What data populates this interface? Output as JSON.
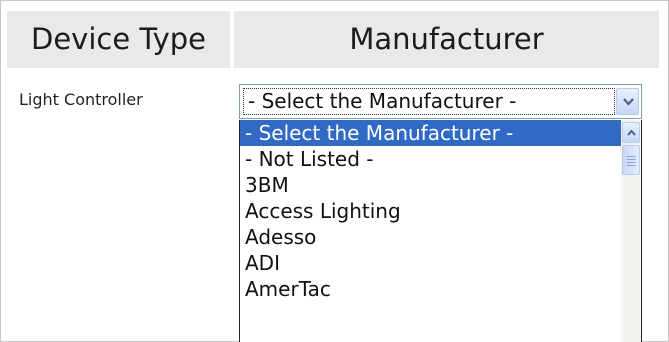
{
  "table": {
    "headers": {
      "device_type": "Device Type",
      "manufacturer": "Manufacturer"
    },
    "row": {
      "label": "Light Controller"
    }
  },
  "select": {
    "value": "- Select the Manufacturer -",
    "options": [
      "- Select the Manufacturer -",
      "- Not Listed -",
      "3BM",
      "Access Lighting",
      "Adesso",
      "ADI",
      "AmerTac"
    ],
    "selected_index": 0
  },
  "colors": {
    "header_bg": "#e9e9e9",
    "selection": "#316ac5"
  },
  "icons": {
    "dropdown": "chevron-down-icon",
    "scroll_up": "chevron-up-icon"
  }
}
